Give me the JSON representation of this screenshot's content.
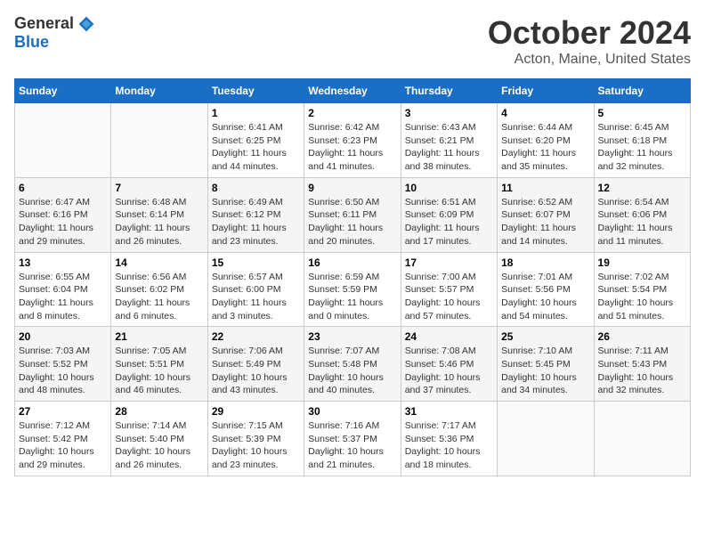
{
  "header": {
    "logo_general": "General",
    "logo_blue": "Blue",
    "month": "October 2024",
    "location": "Acton, Maine, United States"
  },
  "days_of_week": [
    "Sunday",
    "Monday",
    "Tuesday",
    "Wednesday",
    "Thursday",
    "Friday",
    "Saturday"
  ],
  "weeks": [
    [
      {
        "day": "",
        "info": ""
      },
      {
        "day": "",
        "info": ""
      },
      {
        "day": "1",
        "info": "Sunrise: 6:41 AM\nSunset: 6:25 PM\nDaylight: 11 hours and 44 minutes."
      },
      {
        "day": "2",
        "info": "Sunrise: 6:42 AM\nSunset: 6:23 PM\nDaylight: 11 hours and 41 minutes."
      },
      {
        "day": "3",
        "info": "Sunrise: 6:43 AM\nSunset: 6:21 PM\nDaylight: 11 hours and 38 minutes."
      },
      {
        "day": "4",
        "info": "Sunrise: 6:44 AM\nSunset: 6:20 PM\nDaylight: 11 hours and 35 minutes."
      },
      {
        "day": "5",
        "info": "Sunrise: 6:45 AM\nSunset: 6:18 PM\nDaylight: 11 hours and 32 minutes."
      }
    ],
    [
      {
        "day": "6",
        "info": "Sunrise: 6:47 AM\nSunset: 6:16 PM\nDaylight: 11 hours and 29 minutes."
      },
      {
        "day": "7",
        "info": "Sunrise: 6:48 AM\nSunset: 6:14 PM\nDaylight: 11 hours and 26 minutes."
      },
      {
        "day": "8",
        "info": "Sunrise: 6:49 AM\nSunset: 6:12 PM\nDaylight: 11 hours and 23 minutes."
      },
      {
        "day": "9",
        "info": "Sunrise: 6:50 AM\nSunset: 6:11 PM\nDaylight: 11 hours and 20 minutes."
      },
      {
        "day": "10",
        "info": "Sunrise: 6:51 AM\nSunset: 6:09 PM\nDaylight: 11 hours and 17 minutes."
      },
      {
        "day": "11",
        "info": "Sunrise: 6:52 AM\nSunset: 6:07 PM\nDaylight: 11 hours and 14 minutes."
      },
      {
        "day": "12",
        "info": "Sunrise: 6:54 AM\nSunset: 6:06 PM\nDaylight: 11 hours and 11 minutes."
      }
    ],
    [
      {
        "day": "13",
        "info": "Sunrise: 6:55 AM\nSunset: 6:04 PM\nDaylight: 11 hours and 8 minutes."
      },
      {
        "day": "14",
        "info": "Sunrise: 6:56 AM\nSunset: 6:02 PM\nDaylight: 11 hours and 6 minutes."
      },
      {
        "day": "15",
        "info": "Sunrise: 6:57 AM\nSunset: 6:00 PM\nDaylight: 11 hours and 3 minutes."
      },
      {
        "day": "16",
        "info": "Sunrise: 6:59 AM\nSunset: 5:59 PM\nDaylight: 11 hours and 0 minutes."
      },
      {
        "day": "17",
        "info": "Sunrise: 7:00 AM\nSunset: 5:57 PM\nDaylight: 10 hours and 57 minutes."
      },
      {
        "day": "18",
        "info": "Sunrise: 7:01 AM\nSunset: 5:56 PM\nDaylight: 10 hours and 54 minutes."
      },
      {
        "day": "19",
        "info": "Sunrise: 7:02 AM\nSunset: 5:54 PM\nDaylight: 10 hours and 51 minutes."
      }
    ],
    [
      {
        "day": "20",
        "info": "Sunrise: 7:03 AM\nSunset: 5:52 PM\nDaylight: 10 hours and 48 minutes."
      },
      {
        "day": "21",
        "info": "Sunrise: 7:05 AM\nSunset: 5:51 PM\nDaylight: 10 hours and 46 minutes."
      },
      {
        "day": "22",
        "info": "Sunrise: 7:06 AM\nSunset: 5:49 PM\nDaylight: 10 hours and 43 minutes."
      },
      {
        "day": "23",
        "info": "Sunrise: 7:07 AM\nSunset: 5:48 PM\nDaylight: 10 hours and 40 minutes."
      },
      {
        "day": "24",
        "info": "Sunrise: 7:08 AM\nSunset: 5:46 PM\nDaylight: 10 hours and 37 minutes."
      },
      {
        "day": "25",
        "info": "Sunrise: 7:10 AM\nSunset: 5:45 PM\nDaylight: 10 hours and 34 minutes."
      },
      {
        "day": "26",
        "info": "Sunrise: 7:11 AM\nSunset: 5:43 PM\nDaylight: 10 hours and 32 minutes."
      }
    ],
    [
      {
        "day": "27",
        "info": "Sunrise: 7:12 AM\nSunset: 5:42 PM\nDaylight: 10 hours and 29 minutes."
      },
      {
        "day": "28",
        "info": "Sunrise: 7:14 AM\nSunset: 5:40 PM\nDaylight: 10 hours and 26 minutes."
      },
      {
        "day": "29",
        "info": "Sunrise: 7:15 AM\nSunset: 5:39 PM\nDaylight: 10 hours and 23 minutes."
      },
      {
        "day": "30",
        "info": "Sunrise: 7:16 AM\nSunset: 5:37 PM\nDaylight: 10 hours and 21 minutes."
      },
      {
        "day": "31",
        "info": "Sunrise: 7:17 AM\nSunset: 5:36 PM\nDaylight: 10 hours and 18 minutes."
      },
      {
        "day": "",
        "info": ""
      },
      {
        "day": "",
        "info": ""
      }
    ]
  ]
}
